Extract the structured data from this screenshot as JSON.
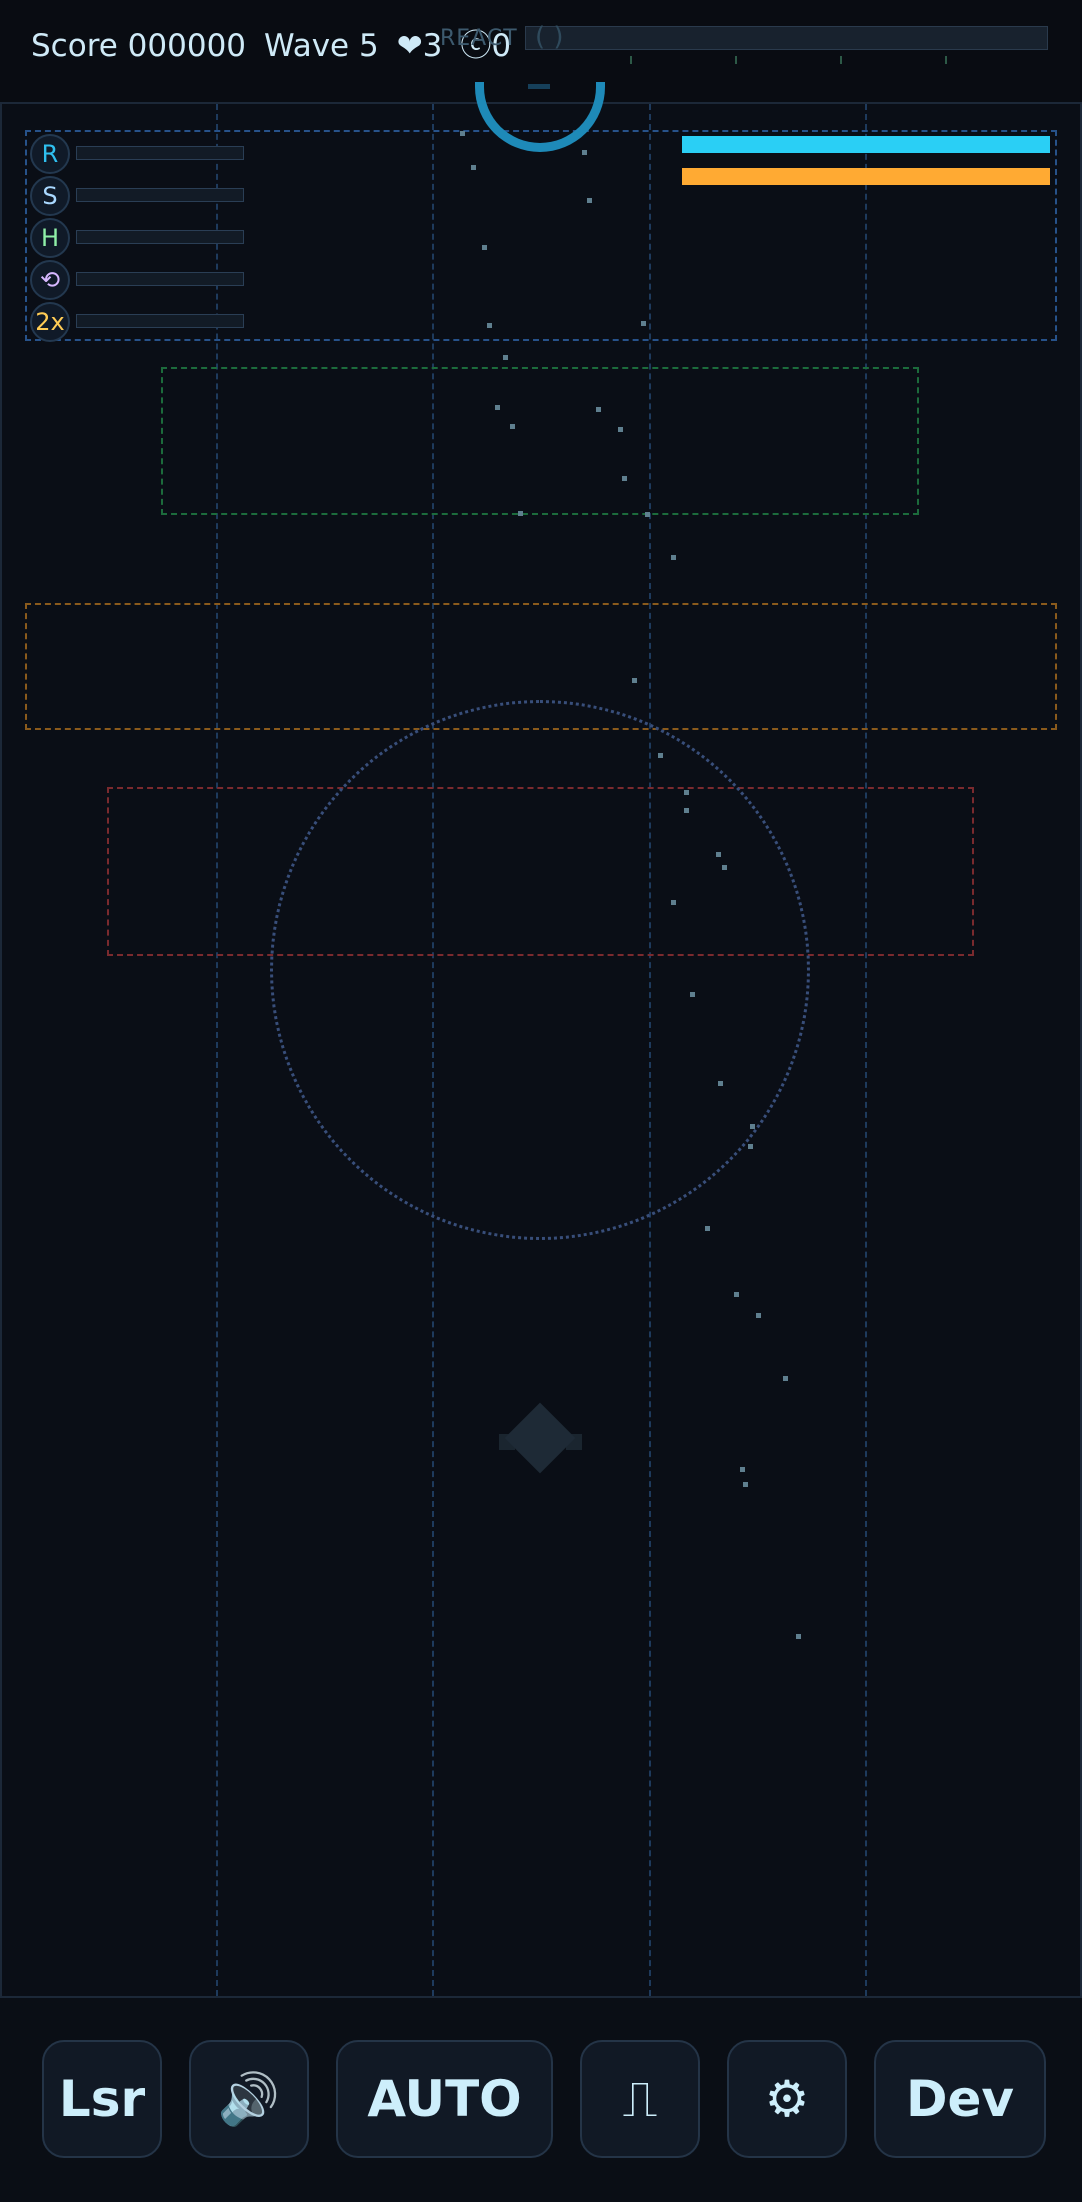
{
  "hud": {
    "score_label": "Score 000000",
    "wave_label": "Wave 5",
    "lives_label": "❤3",
    "coins_label": "ⓒ0",
    "react_label": "REACT",
    "react_paren": "(   )"
  },
  "powerups": [
    {
      "label": "R",
      "color": "#2fc0f0"
    },
    {
      "label": "S",
      "color": "#a9d8ff"
    },
    {
      "label": "H",
      "color": "#8ff0a8"
    },
    {
      "label": "⟲",
      "color": "#d7b8ff"
    },
    {
      "label": "2x",
      "color": "#ffcc55"
    }
  ],
  "meters": {
    "shield_color": "#2acff5",
    "energy_color": "#ffaa33",
    "shield_level": 1.0,
    "energy_level": 1.0
  },
  "controls": {
    "laser": "Lsr",
    "sound": "🔊",
    "auto": "AUTO",
    "wave": "⎍",
    "settings": "⚙",
    "dev": "Dev"
  }
}
